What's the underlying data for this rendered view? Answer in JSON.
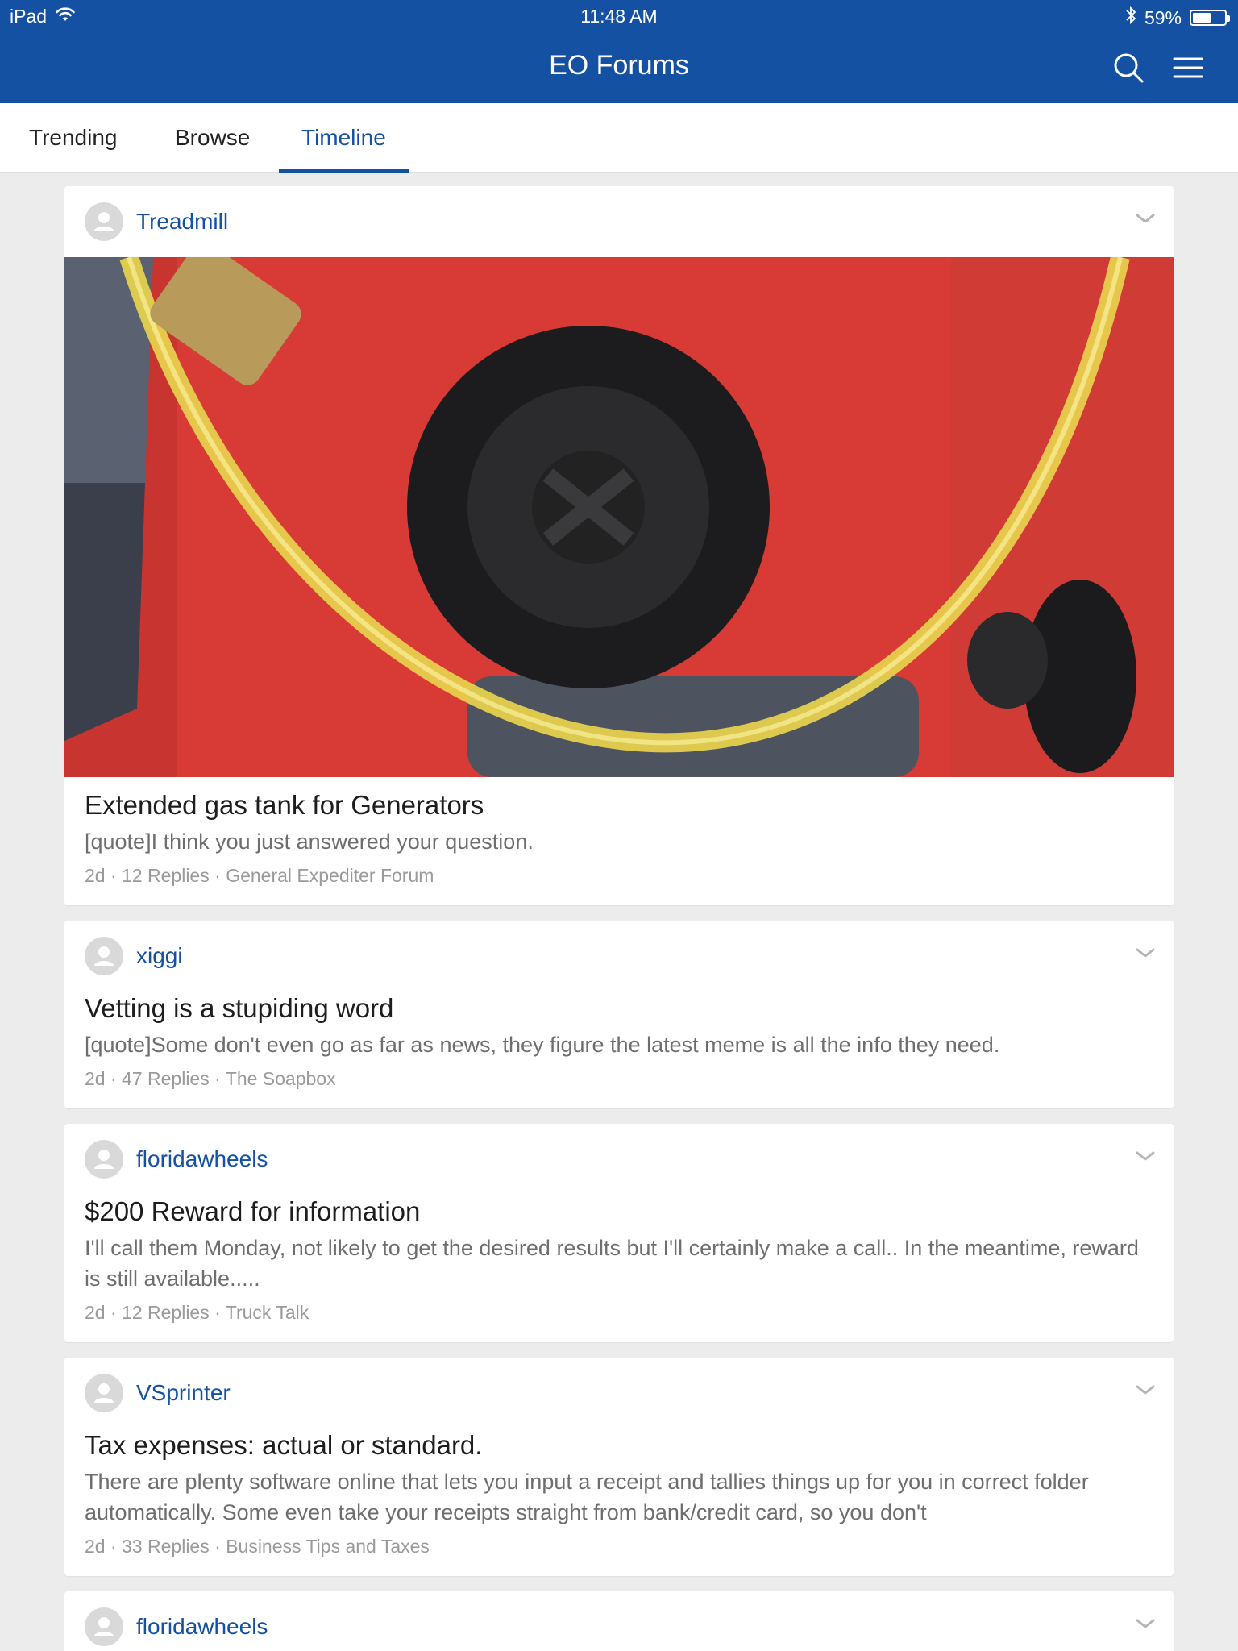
{
  "status_bar": {
    "device": "iPad",
    "time": "11:48 AM",
    "battery": "59%",
    "battery_level": 0.59
  },
  "app_bar": {
    "title": "EO Forums",
    "search_icon": "search-icon",
    "menu_icon": "hamburger-menu-icon"
  },
  "tabs": [
    {
      "label": "Trending",
      "active": false
    },
    {
      "label": "Browse",
      "active": false
    },
    {
      "label": "Timeline",
      "active": true
    }
  ],
  "posts": [
    {
      "author": "Treadmill",
      "has_image": true,
      "title": "Extended gas tank for Generators",
      "excerpt": "[quote]I think you just answered your question.",
      "age": "2d",
      "replies": "12 Replies",
      "forum": "General Expediter Forum"
    },
    {
      "author": "xiggi",
      "has_image": false,
      "title": "Vetting is a stupiding word",
      "excerpt": "[quote]Some don't even go as far as news, they figure the latest meme is all the info they need.",
      "age": "2d",
      "replies": "47 Replies",
      "forum": "The Soapbox"
    },
    {
      "author": "floridawheels",
      "has_image": false,
      "title": "$200 Reward for information",
      "excerpt": "I'll call them Monday, not likely to get the desired results but I'll certainly make a call..  In the meantime, reward is still available.....",
      "age": "2d",
      "replies": "12 Replies",
      "forum": "Truck Talk"
    },
    {
      "author": "VSprinter",
      "has_image": false,
      "title": "Tax expenses: actual or standard.",
      "excerpt": "There are plenty software online that lets you input a receipt and tallies things up for you in correct folder automatically. Some even take your receipts straight from bank/credit card, so you don't",
      "age": "2d",
      "replies": "33 Replies",
      "forum": "Business Tips and Taxes"
    },
    {
      "author": "floridawheels",
      "has_image": false,
      "title": "",
      "excerpt": "",
      "age": "",
      "replies": "",
      "forum": ""
    }
  ],
  "colors": {
    "brand": "#1451a3",
    "background": "#ececec",
    "card": "#ffffff",
    "muted_text": "#9a9a9a"
  }
}
